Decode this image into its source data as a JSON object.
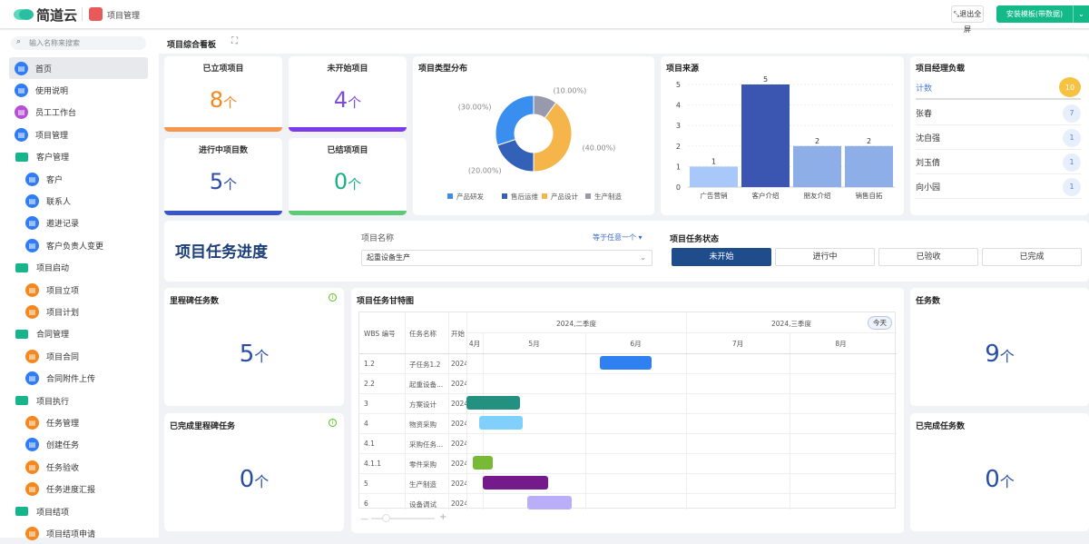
{
  "header": {
    "brand": "简道云",
    "app": "项目管理",
    "exit_fullscreen": "退出全屏",
    "install": "安装模板(带数据)"
  },
  "sidebar": {
    "search_placeholder": "输入名称来搜索",
    "items": [
      {
        "label": "首页",
        "type": "top",
        "color": "#2f7cf6",
        "active": true
      },
      {
        "label": "使用说明",
        "type": "top",
        "color": "#2f7cf6"
      },
      {
        "label": "员工工作台",
        "type": "top",
        "color": "#b44fd6"
      },
      {
        "label": "项目管理",
        "type": "top",
        "color": "#2f7cf6"
      },
      {
        "label": "客户管理",
        "type": "folder"
      },
      {
        "label": "客户",
        "type": "sub",
        "color": "#2f7cf6"
      },
      {
        "label": "联系人",
        "type": "sub",
        "color": "#2f7cf6"
      },
      {
        "label": "邀进记录",
        "type": "sub",
        "color": "#2f7cf6"
      },
      {
        "label": "客户负责人变更",
        "type": "sub",
        "color": "#2f7cf6"
      },
      {
        "label": "项目启动",
        "type": "folder"
      },
      {
        "label": "项目立项",
        "type": "sub",
        "color": "#f5871f"
      },
      {
        "label": "项目计划",
        "type": "sub",
        "color": "#f5871f"
      },
      {
        "label": "合同管理",
        "type": "folder"
      },
      {
        "label": "项目合同",
        "type": "sub",
        "color": "#f5871f"
      },
      {
        "label": "合同附件上传",
        "type": "sub",
        "color": "#2f7cf6"
      },
      {
        "label": "项目执行",
        "type": "folder"
      },
      {
        "label": "任务管理",
        "type": "sub",
        "color": "#f5871f"
      },
      {
        "label": "创建任务",
        "type": "sub",
        "color": "#2f7cf6"
      },
      {
        "label": "任务验收",
        "type": "sub",
        "color": "#f5871f"
      },
      {
        "label": "任务进度汇报",
        "type": "sub",
        "color": "#f5871f"
      },
      {
        "label": "项目结项",
        "type": "folder"
      },
      {
        "label": "项目结项申请",
        "type": "sub",
        "color": "#f5871f"
      }
    ]
  },
  "tab": {
    "label": "项目综合看板"
  },
  "stats": [
    {
      "title": "已立项项目",
      "value": "8",
      "unit": "个",
      "color": "#f5871f",
      "bar": "#f7964a"
    },
    {
      "title": "未开始项目",
      "value": "4",
      "unit": "个",
      "color": "#7c4ddb",
      "bar": "#7c3aed"
    },
    {
      "title": "进行中项目数",
      "value": "5",
      "unit": "个",
      "color": "#2a4ea8",
      "bar": "#3a55c8"
    },
    {
      "title": "已结项项目",
      "value": "0",
      "unit": "个",
      "color": "#1aaf86",
      "bar": "#5bcb78"
    }
  ],
  "chart_data": [
    {
      "type": "pie",
      "title": "项目类型分布",
      "donut": true,
      "slices": [
        {
          "name": "产品研发",
          "value": 30,
          "label": "(30.00%)",
          "color": "#3a8ef0"
        },
        {
          "name": "售后运维",
          "value": 20,
          "label": "(20.00%)",
          "color": "#3461b8"
        },
        {
          "name": "产品设计",
          "value": 40,
          "label": "(40.00%)",
          "color": "#f6b54a"
        },
        {
          "name": "生产制造",
          "value": 10,
          "label": "(10.00%)",
          "color": "#9999ad"
        }
      ],
      "legend": "bottom"
    },
    {
      "type": "bar",
      "title": "项目来源",
      "categories": [
        "广告营销",
        "客户介绍",
        "朋友介绍",
        "销售自拓"
      ],
      "values": [
        1,
        5,
        2,
        2
      ],
      "colors": [
        "#a8c8fa",
        "#3a56b0",
        "#8eaee8",
        "#8eaee8"
      ],
      "ylim": [
        0,
        5
      ],
      "yticks": [
        "0",
        "1",
        "2",
        "3",
        "4",
        "5"
      ]
    }
  ],
  "managers": {
    "title": "项目经理负载",
    "header": {
      "label": "计数",
      "value": "10"
    },
    "rows": [
      {
        "name": "张春",
        "value": "7"
      },
      {
        "name": "沈自强",
        "value": "1"
      },
      {
        "name": "刘玉倩",
        "value": "1"
      },
      {
        "name": "向小园",
        "value": "1"
      }
    ]
  },
  "filter": {
    "title": "项目任务进度",
    "field_label": "项目名称",
    "operator": "等于任意一个",
    "value": "起重设备生产",
    "status_label": "项目任务状态",
    "statuses": [
      "未开始",
      "进行中",
      "已验收",
      "已完成"
    ]
  },
  "milestone": {
    "title": "里程碑任务数",
    "value": "5",
    "unit": "个"
  },
  "milestone_done": {
    "title": "已完成里程碑任务",
    "value": "0",
    "unit": "个"
  },
  "tasks": {
    "title": "任务数",
    "value": "9",
    "unit": "个"
  },
  "tasks_done": {
    "title": "已完成任务数",
    "value": "0",
    "unit": "个"
  },
  "gantt": {
    "title": "项目任务甘特图",
    "col_wbs": "WBS 编号",
    "col_name": "任务名称",
    "col_start": "开始",
    "quarters": [
      "2024,二季度",
      "2024,三季度"
    ],
    "months": [
      "4月",
      "5月",
      "6月",
      "7月",
      "8月"
    ],
    "today": "今天",
    "rows": [
      {
        "wbs": "1.2",
        "name": "子任务1.2",
        "start": "2024",
        "bar": [
          0.31,
          0.43
        ],
        "color": "#2f80f0"
      },
      {
        "wbs": "2.2",
        "name": "起重设备...",
        "start": "2024"
      },
      {
        "wbs": "3",
        "name": "方案设计",
        "start": "2024",
        "bar": [
          0.0,
          0.125
        ],
        "color": "#239080"
      },
      {
        "wbs": "4",
        "name": "物资采购",
        "start": "2024",
        "bar": [
          0.03,
          0.13
        ],
        "color": "#80d0fc"
      },
      {
        "wbs": "4.1",
        "name": "采购任务...",
        "start": "2024"
      },
      {
        "wbs": "4.1.1",
        "name": "零件采购",
        "start": "2024",
        "bar": [
          0.014,
          0.062
        ],
        "color": "#78b936"
      },
      {
        "wbs": "5",
        "name": "生产制造",
        "start": "2024",
        "bar": [
          0.038,
          0.19
        ],
        "color": "#751a8a"
      },
      {
        "wbs": "6",
        "name": "设备调试",
        "start": "2024",
        "bar": [
          0.142,
          0.245
        ],
        "color": "#b9aef7"
      }
    ]
  }
}
